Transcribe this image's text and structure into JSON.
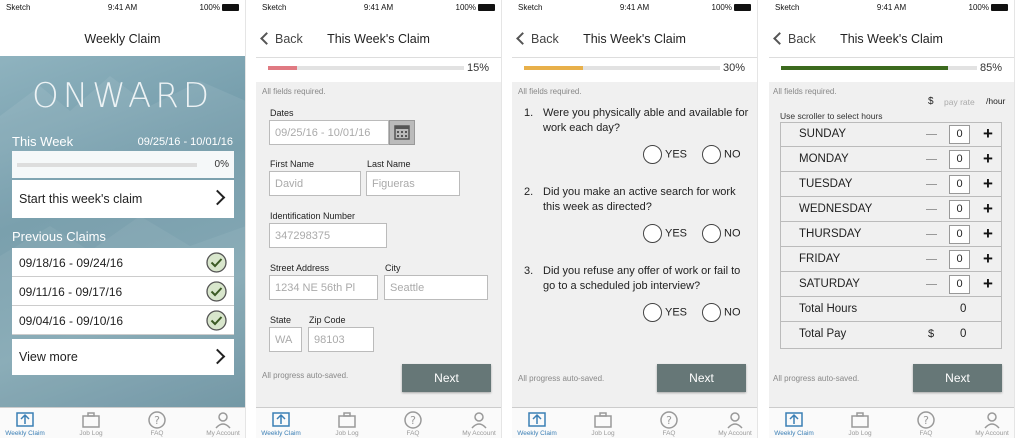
{
  "status": {
    "carrier": "Sketch",
    "time": "9:41 AM",
    "battery": "100%"
  },
  "tabs": [
    {
      "label": "Weekly Claim",
      "icon": "weekly-claim-icon"
    },
    {
      "label": "Job Log",
      "icon": "briefcase-icon"
    },
    {
      "label": "FAQ",
      "icon": "question-icon"
    },
    {
      "label": "My Account",
      "icon": "person-icon"
    }
  ],
  "screen1": {
    "title": "Weekly Claim",
    "logo": "ONWARD",
    "this_week_label": "This Week",
    "this_week_range": "09/25/16 - 10/01/16",
    "progress_pct": "0%",
    "progress_value": 0,
    "start_claim": "Start this week's claim",
    "previous_label": "Previous Claims",
    "previous": [
      "09/18/16 - 09/24/16",
      "09/11/16 - 09/17/16",
      "09/04/16 - 09/10/16"
    ],
    "view_more": "View more"
  },
  "screen2": {
    "back": "Back",
    "title": "This Week's Claim",
    "pct": "15%",
    "progress_value": 0.15,
    "accent": "#e07a82",
    "required": "All fields required.",
    "dates_label": "Dates",
    "dates_value": "09/25/16 - 10/01/16",
    "first_name_label": "First Name",
    "first_name": "David",
    "last_name_label": "Last Name",
    "last_name": "Figueras",
    "id_label": "Identification Number",
    "id_value": "347298375",
    "street_label": "Street Address",
    "street": "1234 NE 56th Pl",
    "city_label": "City",
    "city": "Seattle",
    "state_label": "State",
    "state": "WA",
    "zip_label": "Zip Code",
    "zip": "98103",
    "autosave": "All progress auto-saved.",
    "next": "Next"
  },
  "screen3": {
    "back": "Back",
    "title": "This Week's Claim",
    "pct": "30%",
    "progress_value": 0.3,
    "accent": "#e8b04a",
    "required": "All fields required.",
    "questions": [
      {
        "num": "1.",
        "text": "Were you physically able and available for work each day?"
      },
      {
        "num": "2.",
        "text": "Did you make an active search for work this week as directed?"
      },
      {
        "num": "3.",
        "text": "Did you refuse any offer of work or fail to go to a scheduled job interview?"
      }
    ],
    "yes": "YES",
    "no": "NO",
    "autosave": "All progress auto-saved.",
    "next": "Next"
  },
  "screen4": {
    "back": "Back",
    "title": "This Week's Claim",
    "pct": "85%",
    "progress_value": 0.85,
    "accent": "#3c6a1e",
    "required": "All fields required.",
    "rate_dollar": "$",
    "rate_placeholder": "pay rate",
    "rate_unit": "/hour",
    "scroller_hint": "Use scroller to select hours",
    "days": [
      {
        "day": "SUNDAY",
        "hours": "0"
      },
      {
        "day": "MONDAY",
        "hours": "0"
      },
      {
        "day": "TUESDAY",
        "hours": "0"
      },
      {
        "day": "WEDNESDAY",
        "hours": "0"
      },
      {
        "day": "THURSDAY",
        "hours": "0"
      },
      {
        "day": "FRIDAY",
        "hours": "0"
      },
      {
        "day": "SATURDAY",
        "hours": "0"
      }
    ],
    "total_hours_label": "Total Hours",
    "total_hours": "0",
    "total_pay_label": "Total Pay",
    "total_pay_dollar": "$",
    "total_pay": "0",
    "autosave": "All progress auto-saved.",
    "next": "Next"
  }
}
